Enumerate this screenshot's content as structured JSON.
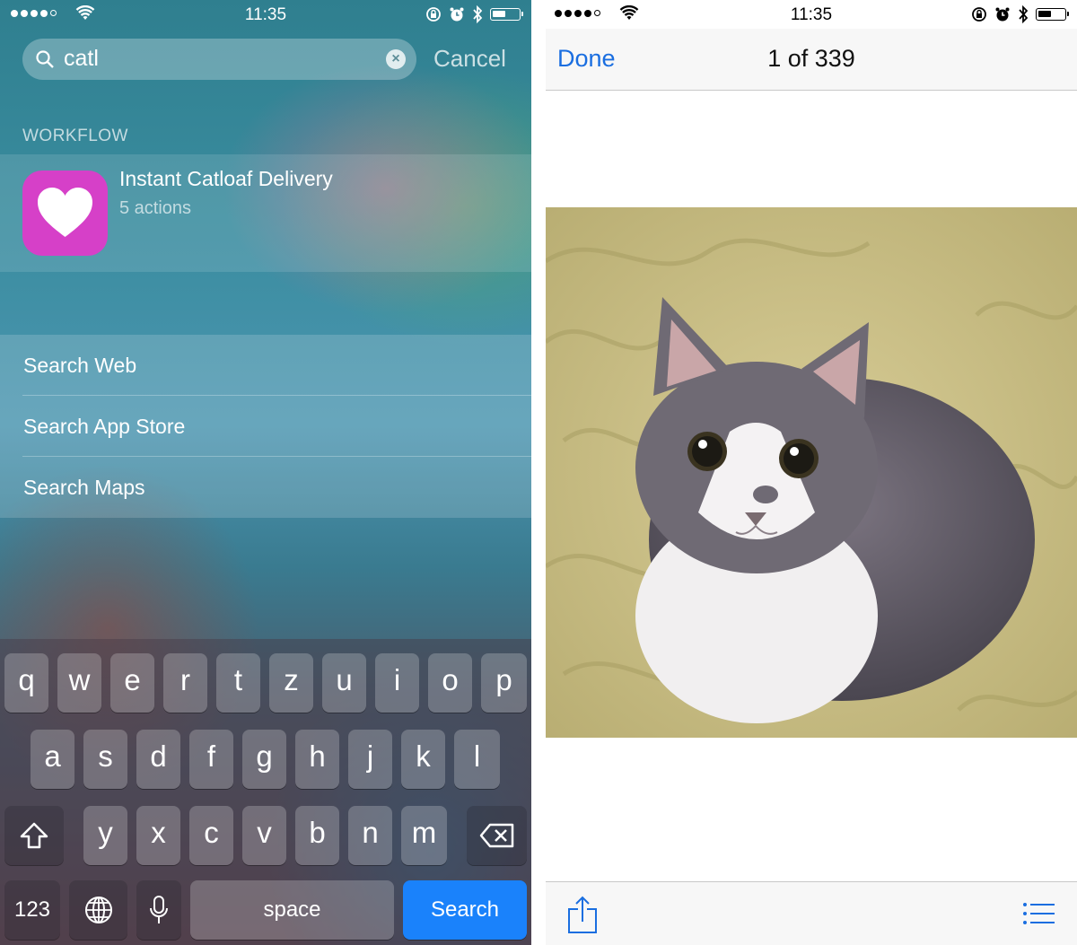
{
  "left": {
    "status": {
      "time": "11:35"
    },
    "search": {
      "query": "catl",
      "cancel_label": "Cancel"
    },
    "section_label": "WORKFLOW",
    "result": {
      "title": "Instant Catloaf Delivery",
      "subtitle": "5 actions"
    },
    "actions": [
      "Search Web",
      "Search App Store",
      "Search Maps"
    ],
    "keyboard": {
      "row1": [
        "q",
        "w",
        "e",
        "r",
        "t",
        "z",
        "u",
        "i",
        "o",
        "p"
      ],
      "row2": [
        "a",
        "s",
        "d",
        "f",
        "g",
        "h",
        "j",
        "k",
        "l"
      ],
      "row3": [
        "y",
        "x",
        "c",
        "v",
        "b",
        "n",
        "m"
      ],
      "numbers_label": "123",
      "space_label": "space",
      "search_label": "Search"
    },
    "colors": {
      "accent": "#1a82fb",
      "app_icon": "#d640c8"
    }
  },
  "right": {
    "status": {
      "time": "11:35"
    },
    "nav": {
      "done_label": "Done",
      "counter": "1 of 339"
    },
    "colors": {
      "tint": "#1a6ee0"
    }
  }
}
